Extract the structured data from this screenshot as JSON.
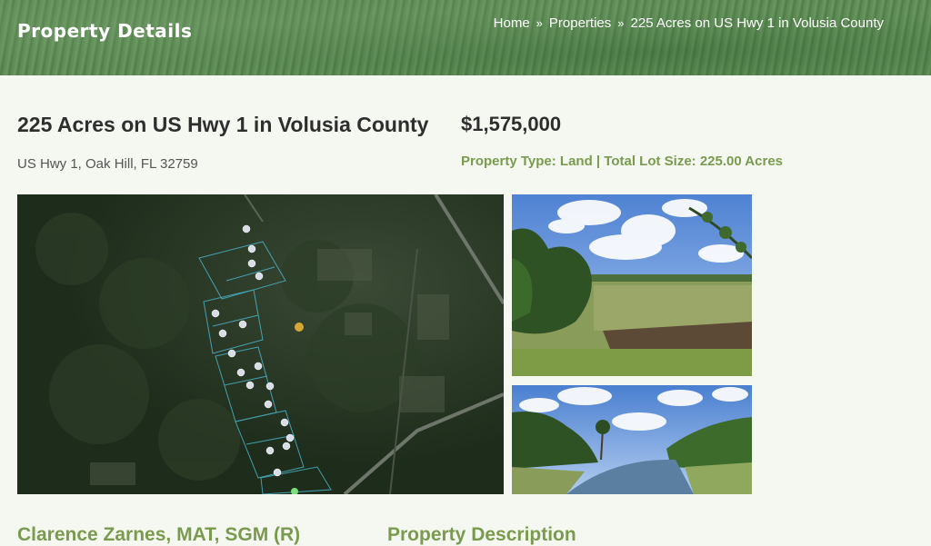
{
  "header": {
    "title": "Property Details",
    "breadcrumb": {
      "home": "Home",
      "sep1": "»",
      "properties": "Properties",
      "sep2": "»",
      "current": "225 Acres on US Hwy 1 in Volusia County"
    }
  },
  "property": {
    "title": "225 Acres on US Hwy 1 in Volusia County",
    "address": "US Hwy 1, Oak Hill, FL 32759",
    "price": "$1,575,000",
    "meta": "Property Type: Land | Total Lot Size: 225.00 Acres"
  },
  "images": {
    "map": "aerial-parcel-map",
    "photo1": "marsh-landscape-photo",
    "photo2": "river-landscape-photo"
  },
  "sections": {
    "agent_name": "Clarence Zarnes, MAT, SGM (R)",
    "description_heading": "Property Description"
  },
  "colors": {
    "accent": "#7a9b4e",
    "text": "#2e2e2e",
    "background": "#f5f8f1"
  }
}
